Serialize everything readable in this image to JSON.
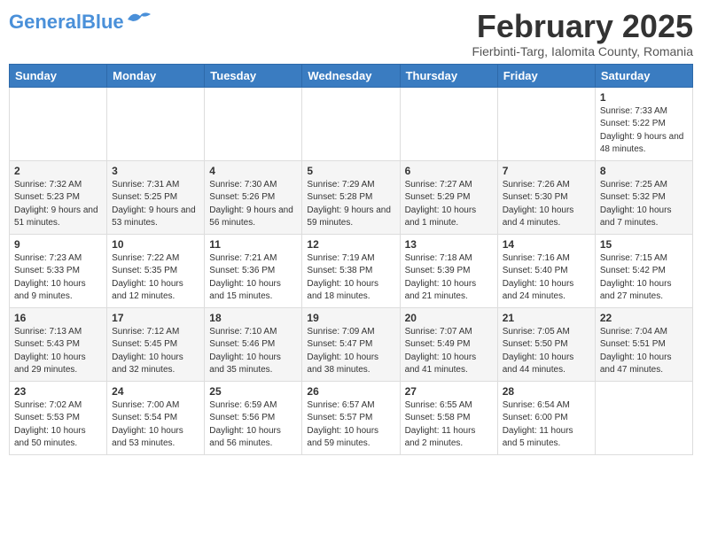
{
  "header": {
    "logo_general": "General",
    "logo_blue": "Blue",
    "month_title": "February 2025",
    "location": "Fierbinti-Targ, Ialomita County, Romania"
  },
  "days_of_week": [
    "Sunday",
    "Monday",
    "Tuesday",
    "Wednesday",
    "Thursday",
    "Friday",
    "Saturday"
  ],
  "weeks": [
    [
      {
        "day": "",
        "info": ""
      },
      {
        "day": "",
        "info": ""
      },
      {
        "day": "",
        "info": ""
      },
      {
        "day": "",
        "info": ""
      },
      {
        "day": "",
        "info": ""
      },
      {
        "day": "",
        "info": ""
      },
      {
        "day": "1",
        "info": "Sunrise: 7:33 AM\nSunset: 5:22 PM\nDaylight: 9 hours and 48 minutes."
      }
    ],
    [
      {
        "day": "2",
        "info": "Sunrise: 7:32 AM\nSunset: 5:23 PM\nDaylight: 9 hours and 51 minutes."
      },
      {
        "day": "3",
        "info": "Sunrise: 7:31 AM\nSunset: 5:25 PM\nDaylight: 9 hours and 53 minutes."
      },
      {
        "day": "4",
        "info": "Sunrise: 7:30 AM\nSunset: 5:26 PM\nDaylight: 9 hours and 56 minutes."
      },
      {
        "day": "5",
        "info": "Sunrise: 7:29 AM\nSunset: 5:28 PM\nDaylight: 9 hours and 59 minutes."
      },
      {
        "day": "6",
        "info": "Sunrise: 7:27 AM\nSunset: 5:29 PM\nDaylight: 10 hours and 1 minute."
      },
      {
        "day": "7",
        "info": "Sunrise: 7:26 AM\nSunset: 5:30 PM\nDaylight: 10 hours and 4 minutes."
      },
      {
        "day": "8",
        "info": "Sunrise: 7:25 AM\nSunset: 5:32 PM\nDaylight: 10 hours and 7 minutes."
      }
    ],
    [
      {
        "day": "9",
        "info": "Sunrise: 7:23 AM\nSunset: 5:33 PM\nDaylight: 10 hours and 9 minutes."
      },
      {
        "day": "10",
        "info": "Sunrise: 7:22 AM\nSunset: 5:35 PM\nDaylight: 10 hours and 12 minutes."
      },
      {
        "day": "11",
        "info": "Sunrise: 7:21 AM\nSunset: 5:36 PM\nDaylight: 10 hours and 15 minutes."
      },
      {
        "day": "12",
        "info": "Sunrise: 7:19 AM\nSunset: 5:38 PM\nDaylight: 10 hours and 18 minutes."
      },
      {
        "day": "13",
        "info": "Sunrise: 7:18 AM\nSunset: 5:39 PM\nDaylight: 10 hours and 21 minutes."
      },
      {
        "day": "14",
        "info": "Sunrise: 7:16 AM\nSunset: 5:40 PM\nDaylight: 10 hours and 24 minutes."
      },
      {
        "day": "15",
        "info": "Sunrise: 7:15 AM\nSunset: 5:42 PM\nDaylight: 10 hours and 27 minutes."
      }
    ],
    [
      {
        "day": "16",
        "info": "Sunrise: 7:13 AM\nSunset: 5:43 PM\nDaylight: 10 hours and 29 minutes."
      },
      {
        "day": "17",
        "info": "Sunrise: 7:12 AM\nSunset: 5:45 PM\nDaylight: 10 hours and 32 minutes."
      },
      {
        "day": "18",
        "info": "Sunrise: 7:10 AM\nSunset: 5:46 PM\nDaylight: 10 hours and 35 minutes."
      },
      {
        "day": "19",
        "info": "Sunrise: 7:09 AM\nSunset: 5:47 PM\nDaylight: 10 hours and 38 minutes."
      },
      {
        "day": "20",
        "info": "Sunrise: 7:07 AM\nSunset: 5:49 PM\nDaylight: 10 hours and 41 minutes."
      },
      {
        "day": "21",
        "info": "Sunrise: 7:05 AM\nSunset: 5:50 PM\nDaylight: 10 hours and 44 minutes."
      },
      {
        "day": "22",
        "info": "Sunrise: 7:04 AM\nSunset: 5:51 PM\nDaylight: 10 hours and 47 minutes."
      }
    ],
    [
      {
        "day": "23",
        "info": "Sunrise: 7:02 AM\nSunset: 5:53 PM\nDaylight: 10 hours and 50 minutes."
      },
      {
        "day": "24",
        "info": "Sunrise: 7:00 AM\nSunset: 5:54 PM\nDaylight: 10 hours and 53 minutes."
      },
      {
        "day": "25",
        "info": "Sunrise: 6:59 AM\nSunset: 5:56 PM\nDaylight: 10 hours and 56 minutes."
      },
      {
        "day": "26",
        "info": "Sunrise: 6:57 AM\nSunset: 5:57 PM\nDaylight: 10 hours and 59 minutes."
      },
      {
        "day": "27",
        "info": "Sunrise: 6:55 AM\nSunset: 5:58 PM\nDaylight: 11 hours and 2 minutes."
      },
      {
        "day": "28",
        "info": "Sunrise: 6:54 AM\nSunset: 6:00 PM\nDaylight: 11 hours and 5 minutes."
      },
      {
        "day": "",
        "info": ""
      }
    ]
  ]
}
